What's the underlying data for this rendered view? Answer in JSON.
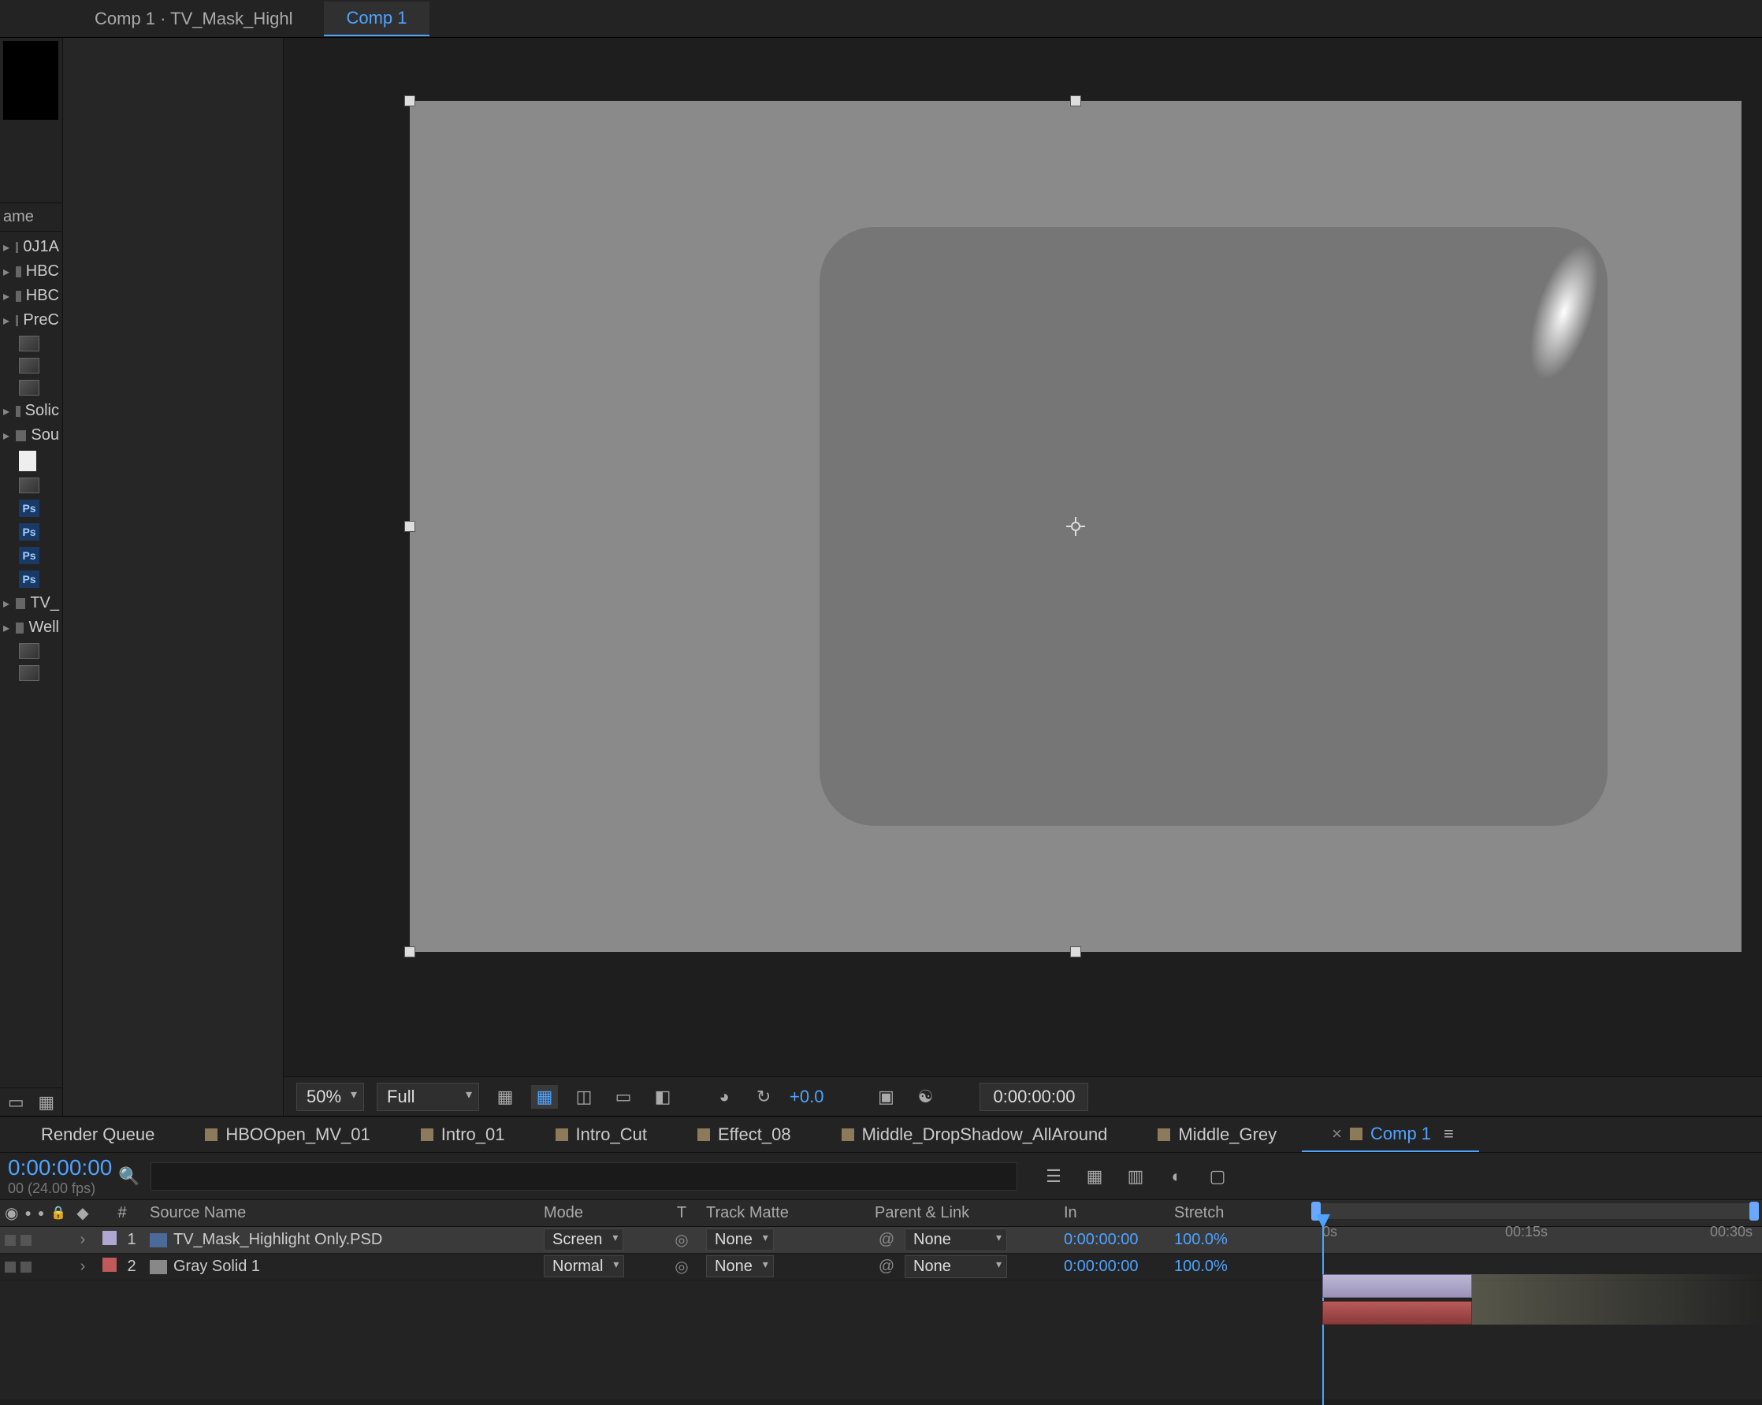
{
  "breadcrumb": "Comp 1 · TV_Mask_Highl",
  "comp_tab": "Comp 1",
  "project": {
    "name_header": "ame",
    "items": [
      {
        "icon": "folder",
        "label": "0J1A"
      },
      {
        "icon": "folder",
        "label": "HBC"
      },
      {
        "icon": "folder",
        "label": "HBC"
      },
      {
        "icon": "folder",
        "label": "PreC"
      },
      {
        "icon": "thumb",
        "label": ""
      },
      {
        "icon": "thumb",
        "label": ""
      },
      {
        "icon": "thumb",
        "label": ""
      },
      {
        "icon": "folder",
        "label": "Solic"
      },
      {
        "icon": "folder",
        "label": "Sou"
      },
      {
        "icon": "doc",
        "label": ""
      },
      {
        "icon": "thumb",
        "label": ""
      },
      {
        "icon": "ps",
        "label": ""
      },
      {
        "icon": "ps",
        "label": ""
      },
      {
        "icon": "ps",
        "label": ""
      },
      {
        "icon": "ps",
        "label": ""
      },
      {
        "icon": "folder",
        "label": "TV_"
      },
      {
        "icon": "folder",
        "label": "Well"
      },
      {
        "icon": "thumb",
        "label": ""
      },
      {
        "icon": "thumb",
        "label": ""
      }
    ]
  },
  "viewer": {
    "zoom": "50%",
    "resolution": "Full",
    "exposure": "+0.0",
    "timecode": "0:00:00:00"
  },
  "timeline": {
    "tabs": [
      {
        "label": "Render Queue",
        "icon": false
      },
      {
        "label": "HBOOpen_MV_01",
        "icon": true
      },
      {
        "label": "Intro_01",
        "icon": true
      },
      {
        "label": "Intro_Cut",
        "icon": true
      },
      {
        "label": "Effect_08",
        "icon": true
      },
      {
        "label": "Middle_DropShadow_AllAround",
        "icon": true
      },
      {
        "label": "Middle_Grey",
        "icon": true
      },
      {
        "label": "Comp 1",
        "icon": true,
        "active": true,
        "closable": true
      }
    ],
    "current_time": "0:00:00:00",
    "fps_label": "00 (24.00 fps)",
    "ruler": {
      "t0": "0s",
      "t1": "00:15s",
      "t2": "00:30s"
    },
    "columns": {
      "num": "#",
      "name": "Source Name",
      "mode": "Mode",
      "t": "T",
      "trk": "Track Matte",
      "parent": "Parent & Link",
      "in": "In",
      "stretch": "Stretch"
    },
    "layers": [
      {
        "num": "1",
        "name": "TV_Mask_Highlight Only.PSD",
        "mode": "Screen",
        "trk": "None",
        "parent": "None",
        "in": "0:00:00:00",
        "stretch": "100.0%",
        "color": "#b0a8d0",
        "icon": "ps",
        "selected": true
      },
      {
        "num": "2",
        "name": "Gray Solid 1",
        "mode": "Normal",
        "trk": "None",
        "parent": "None",
        "in": "0:00:00:00",
        "stretch": "100.0%",
        "color": "#c05a5a",
        "icon": "solid",
        "selected": false
      }
    ]
  }
}
